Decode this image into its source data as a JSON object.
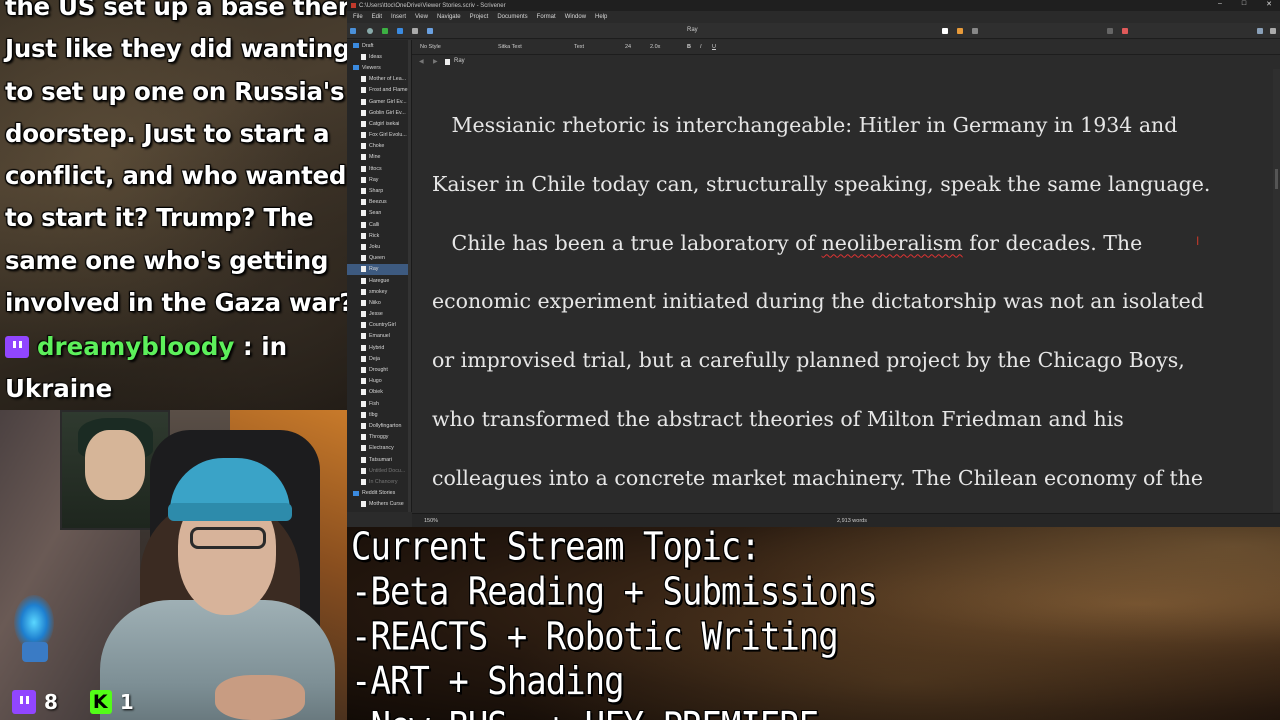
{
  "chat": {
    "message1_lines": [
      "the US set up a base there.",
      "Just like they did wanting",
      "to set up one on Russia's",
      "doorstep. Just to start a",
      "conflict, and who wanted",
      "to start it? Trump? The",
      "same one who's getting",
      "involved in the Gaza war?"
    ],
    "message2": {
      "username": "dreamybloody",
      "separator": " : in",
      "continuation": "Ukraine"
    },
    "colors": {
      "username": "#5df05b",
      "twitch": "#9146ff",
      "kick": "#53fc18"
    }
  },
  "viewers": {
    "twitch_count": "8",
    "kick_count": "1"
  },
  "app": {
    "window_title": "C:\\Users\\ttoc\\OneDrive\\Viewer Stories.scriv - Scrivener",
    "menu": [
      "File",
      "Edit",
      "Insert",
      "View",
      "Navigate",
      "Project",
      "Documents",
      "Format",
      "Window",
      "Help"
    ],
    "toolbar_doc_title": "Ray",
    "format_bar": {
      "style": "No Style",
      "font": "Sitka Text",
      "weight": "Text",
      "size": "24",
      "line_spacing": "2.0x",
      "bold": "B",
      "italic": "I",
      "underline": "U"
    },
    "binder": [
      {
        "label": "Draft",
        "type": "folder"
      },
      {
        "label": "Ideas",
        "type": "doc"
      },
      {
        "label": "Viewers",
        "type": "folder"
      },
      {
        "label": "Mother of Lea...",
        "type": "doc"
      },
      {
        "label": "Frost and Flame",
        "type": "doc"
      },
      {
        "label": "Gamer Girl Ev...",
        "type": "doc"
      },
      {
        "label": "Goblin Girl Ev...",
        "type": "doc"
      },
      {
        "label": "Catgirl isekai",
        "type": "doc"
      },
      {
        "label": "Fox Girl Evolu...",
        "type": "doc"
      },
      {
        "label": "Choke",
        "type": "doc"
      },
      {
        "label": "Mine",
        "type": "doc"
      },
      {
        "label": "Ittocs",
        "type": "doc"
      },
      {
        "label": "Ray",
        "type": "doc"
      },
      {
        "label": "Sharp",
        "type": "doc"
      },
      {
        "label": "Beezus",
        "type": "doc"
      },
      {
        "label": "Sean",
        "type": "doc"
      },
      {
        "label": "Calli",
        "type": "doc"
      },
      {
        "label": "Rick",
        "type": "doc"
      },
      {
        "label": "Joku",
        "type": "doc"
      },
      {
        "label": "Queen",
        "type": "doc"
      },
      {
        "label": "Ray",
        "type": "doc",
        "selected": true
      },
      {
        "label": "Haregue",
        "type": "doc"
      },
      {
        "label": "smokey",
        "type": "doc"
      },
      {
        "label": "Niiko",
        "type": "doc"
      },
      {
        "label": "Jesse",
        "type": "doc"
      },
      {
        "label": "CountryGirl",
        "type": "doc"
      },
      {
        "label": "Emanuel",
        "type": "doc"
      },
      {
        "label": "Hybrid",
        "type": "doc"
      },
      {
        "label": "Deja",
        "type": "doc"
      },
      {
        "label": "Drought",
        "type": "doc"
      },
      {
        "label": "Hugo",
        "type": "doc"
      },
      {
        "label": "Obiek",
        "type": "doc"
      },
      {
        "label": "Fish",
        "type": "doc"
      },
      {
        "label": "tlbg",
        "type": "doc"
      },
      {
        "label": "Dollyfingarton",
        "type": "doc"
      },
      {
        "label": "Throggy",
        "type": "doc"
      },
      {
        "label": "Electrancy",
        "type": "doc"
      },
      {
        "label": "Tatsumari",
        "type": "doc"
      },
      {
        "label": "Untitled Docu...",
        "type": "doc",
        "dim": true
      },
      {
        "label": "In Chancery",
        "type": "doc",
        "dim": true
      },
      {
        "label": "Reddit Stories",
        "type": "folder"
      },
      {
        "label": "Mothers Curse",
        "type": "doc"
      }
    ],
    "editor_header_title": "Ray",
    "editor_lines": [
      "   Messianic rhetoric is interchangeable: Hitler in Germany in 1934 and",
      "Kaiser in Chile today can, structurally speaking, speak the same language.",
      "   Chile has been a true laboratory of ",
      "economic experiment initiated during the dictatorship was not an isolated",
      "or improvised trial, but a carefully planned project by the Chicago Boys,",
      "who transformed the abstract theories of Milton Friedman and his",
      "colleagues into a concrete market machinery. The Chilean economy of the"
    ],
    "misspelled_word": "neoliberalism",
    "line3_tail": " for decades. The",
    "status": {
      "zoom": "150%",
      "word_count": "2,913 words"
    }
  },
  "stream_topic": {
    "lines": [
      "Current Stream Topic:",
      "-Beta Reading + Submissions",
      "-REACTS + Robotic Writing",
      "-ART + Shading",
      "-New BHS  + HFY PREMIERE"
    ]
  }
}
